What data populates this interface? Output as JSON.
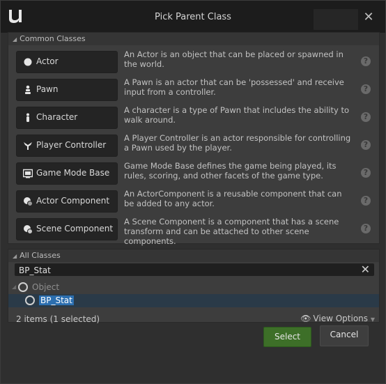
{
  "window": {
    "title": "Pick Parent Class",
    "close_glyph": "✕"
  },
  "common": {
    "header": "Common Classes",
    "items": [
      {
        "label": "Actor",
        "icon": "actor-icon",
        "description": "An Actor is an object that can be placed or spawned in the world."
      },
      {
        "label": "Pawn",
        "icon": "pawn-icon",
        "description": "A Pawn is an actor that can be 'possessed' and receive input from a controller."
      },
      {
        "label": "Character",
        "icon": "character-icon",
        "description": "A character is a type of Pawn that includes the ability to walk around."
      },
      {
        "label": "Player Controller",
        "icon": "player-controller-icon",
        "description": "A Player Controller is an actor responsible for controlling a Pawn used by the player."
      },
      {
        "label": "Game Mode Base",
        "icon": "game-mode-icon",
        "description": "Game Mode Base defines the game being played, its rules, scoring, and other facets of the game type."
      },
      {
        "label": "Actor Component",
        "icon": "actor-component-icon",
        "description": "An ActorComponent is a reusable component that can be added to any actor."
      },
      {
        "label": "Scene Component",
        "icon": "scene-component-icon",
        "description": "A Scene Component is a component that has a scene transform and can be attached to other scene components."
      }
    ],
    "help_glyph": "?"
  },
  "all": {
    "header": "All Classes",
    "search_value": "BP_Stat",
    "clear_glyph": "✕",
    "tree": [
      {
        "label": "Object"
      },
      {
        "label": "BP_Stat"
      }
    ],
    "status": "2 items (1 selected)",
    "view_options": "View Options"
  },
  "footer": {
    "select_label": "Select",
    "cancel_label": "Cancel"
  },
  "colors": {
    "select_button": "#3d6f28",
    "selection_highlight": "#2c6fb0"
  }
}
